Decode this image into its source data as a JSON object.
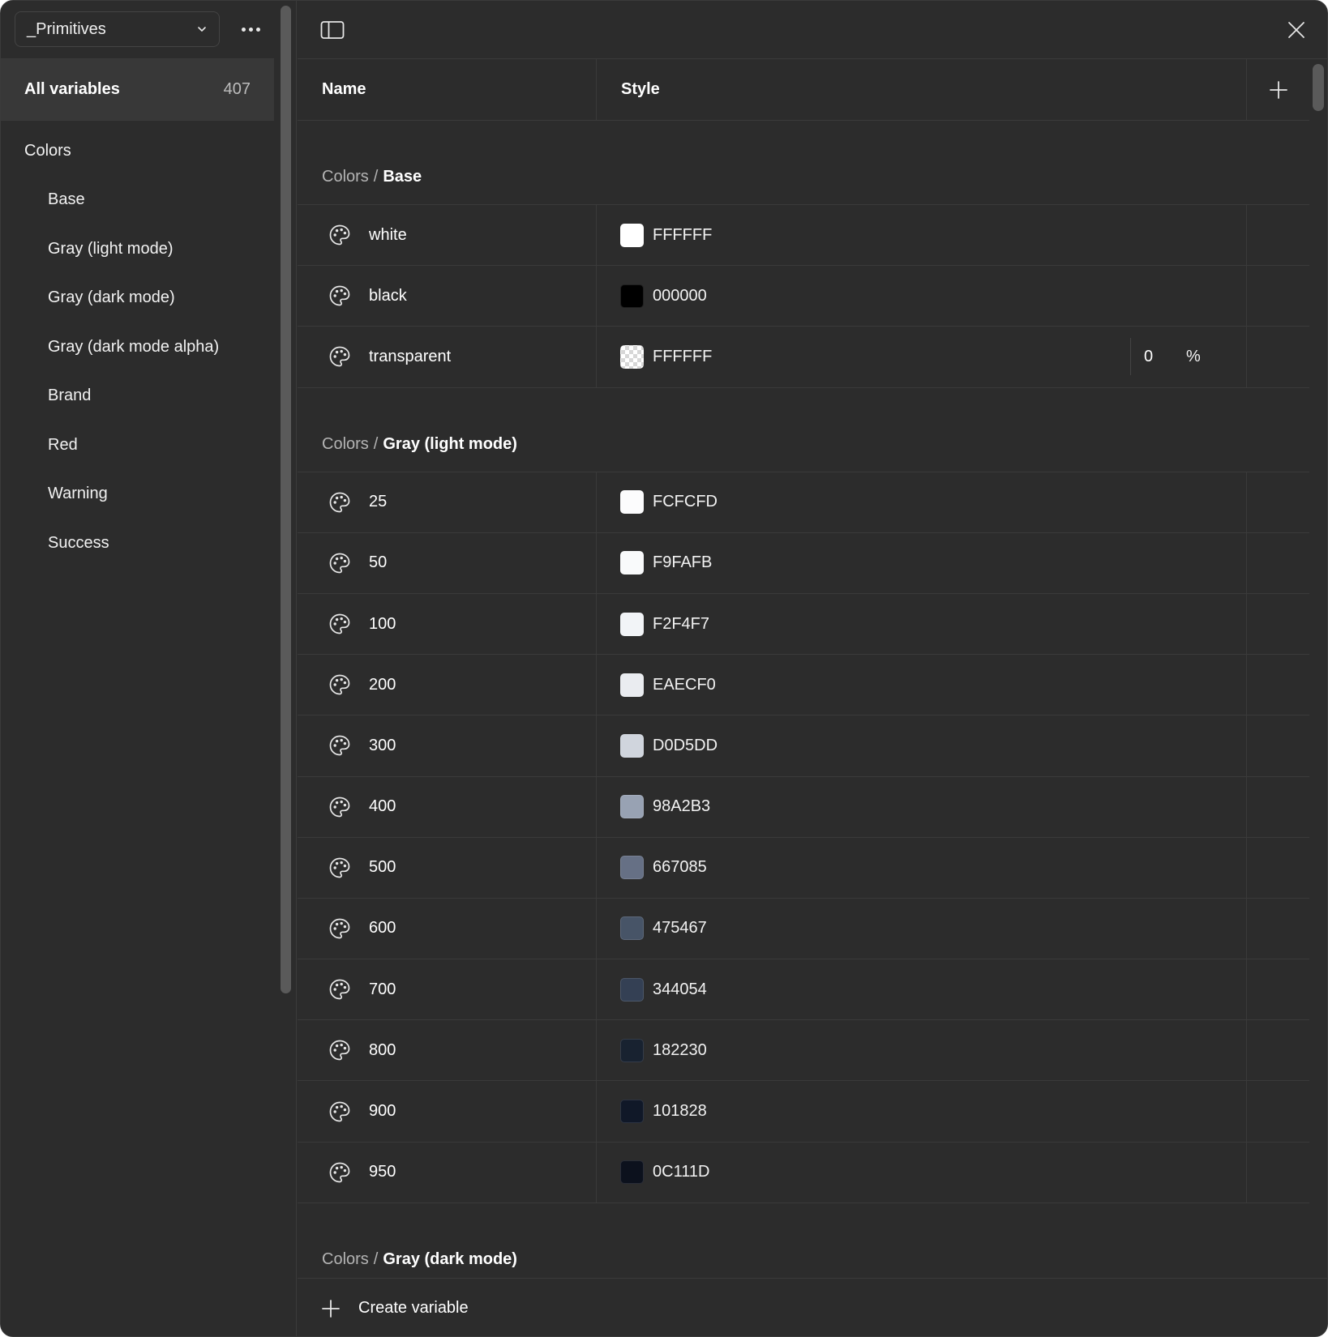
{
  "collection": {
    "name": "_Primitives"
  },
  "sidebar": {
    "all_variables": {
      "label": "All variables",
      "count": "407"
    },
    "groups": [
      {
        "label": "Colors",
        "level": 0
      },
      {
        "label": "Base",
        "level": 1
      },
      {
        "label": "Gray (light mode)",
        "level": 1
      },
      {
        "label": "Gray (dark mode)",
        "level": 1
      },
      {
        "label": "Gray (dark mode alpha)",
        "level": 1
      },
      {
        "label": "Brand",
        "level": 1
      },
      {
        "label": "Red",
        "level": 1
      },
      {
        "label": "Warning",
        "level": 1
      },
      {
        "label": "Success",
        "level": 1
      }
    ]
  },
  "table": {
    "headers": {
      "name": "Name",
      "style": "Style"
    },
    "sections": [
      {
        "prefix": "Colors",
        "separator": "/",
        "group": "Base",
        "rows": [
          {
            "name": "white",
            "value": "FFFFFF",
            "swatch": "#FFFFFF"
          },
          {
            "name": "black",
            "value": "000000",
            "swatch": "#000000"
          },
          {
            "name": "transparent",
            "value": "FFFFFF",
            "swatch": "checker",
            "alpha": "0",
            "alpha_unit": "%"
          }
        ]
      },
      {
        "prefix": "Colors",
        "separator": "/",
        "group": "Gray (light mode)",
        "rows": [
          {
            "name": "25",
            "value": "FCFCFD",
            "swatch": "#FCFCFD"
          },
          {
            "name": "50",
            "value": "F9FAFB",
            "swatch": "#F9FAFB"
          },
          {
            "name": "100",
            "value": "F2F4F7",
            "swatch": "#F2F4F7"
          },
          {
            "name": "200",
            "value": "EAECF0",
            "swatch": "#EAECF0"
          },
          {
            "name": "300",
            "value": "D0D5DD",
            "swatch": "#D0D5DD"
          },
          {
            "name": "400",
            "value": "98A2B3",
            "swatch": "#98A2B3"
          },
          {
            "name": "500",
            "value": "667085",
            "swatch": "#667085"
          },
          {
            "name": "600",
            "value": "475467",
            "swatch": "#475467"
          },
          {
            "name": "700",
            "value": "344054",
            "swatch": "#344054"
          },
          {
            "name": "800",
            "value": "182230",
            "swatch": "#182230"
          },
          {
            "name": "900",
            "value": "101828",
            "swatch": "#101828"
          },
          {
            "name": "950",
            "value": "0C111D",
            "swatch": "#0C111D"
          }
        ]
      },
      {
        "prefix": "Colors",
        "separator": "/",
        "group": "Gray (dark mode)",
        "rows": []
      }
    ]
  },
  "footer": {
    "create_label": "Create variable"
  },
  "icons": {
    "collection_dropdown": "chevron-down-icon",
    "more": "more-horizontal-icon",
    "sidebar_toggle": "sidebar-toggle-icon",
    "close": "close-icon",
    "add": "plus-icon",
    "variable_type": "palette-icon"
  }
}
